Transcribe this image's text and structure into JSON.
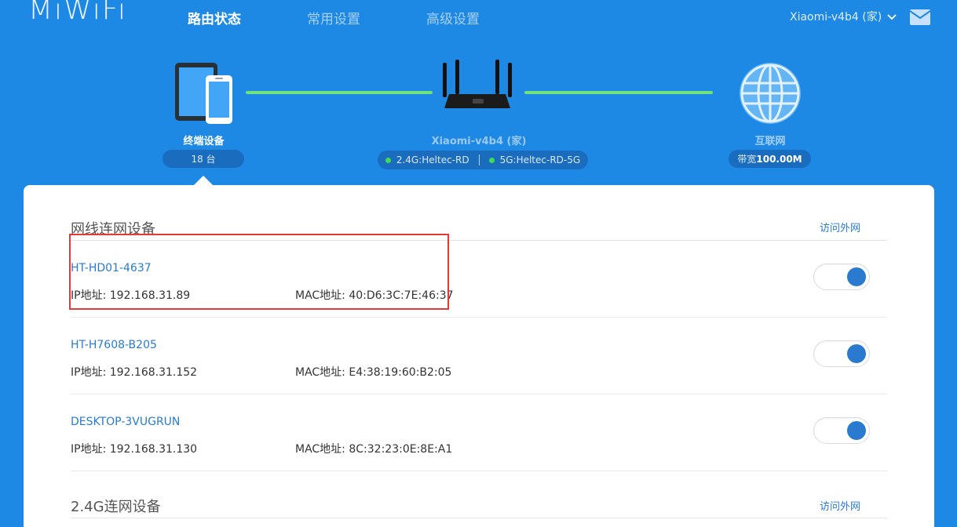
{
  "header": {
    "logo": "MiWiFi",
    "nav": [
      "路由状态",
      "常用设置",
      "高级设置"
    ],
    "active_nav": "路由状态",
    "router_selector": "Xiaomi-v4b4 (家)",
    "icons": [
      "chevron-down-icon",
      "mail-icon"
    ]
  },
  "topology": {
    "devices": {
      "label": "终端设备",
      "count": "18 台"
    },
    "router": {
      "name": "Xiaomi-v4b4 (家)",
      "wifi_24": "2.4G:Heltec-RD",
      "wifi_5": "5G:Heltec-RD-5G"
    },
    "internet": {
      "label": "互联网",
      "bandwidth_prefix": "带宽",
      "bandwidth_value": "100.00M"
    },
    "colors": {
      "background": "#1e88e5",
      "link_line": "#6fe37a",
      "status_dot": "#3ddc52"
    }
  },
  "wired": {
    "title": "网线连网设备",
    "link": "访问外网",
    "devices": [
      {
        "name": "HT-HD01-4637",
        "ip": "IP地址: 192.168.31.89",
        "mac": "MAC地址: 40:D6:3C:7E:46:37",
        "internet_access": true
      },
      {
        "name": "HT-H7608-B205",
        "ip": "IP地址: 192.168.31.152",
        "mac": "MAC地址: E4:38:19:60:B2:05",
        "internet_access": true
      },
      {
        "name": "DESKTOP-3VUGRUN",
        "ip": "IP地址: 192.168.31.130",
        "mac": "MAC地址: 8C:32:23:0E:8E:A1",
        "internet_access": true
      }
    ]
  },
  "wifi24": {
    "title": "2.4G连网设备",
    "link": "访问外网"
  },
  "colors": {
    "link": "#2a7bd0",
    "toggle_on": "#2a7bd0",
    "highlight_box": "#e53935"
  }
}
